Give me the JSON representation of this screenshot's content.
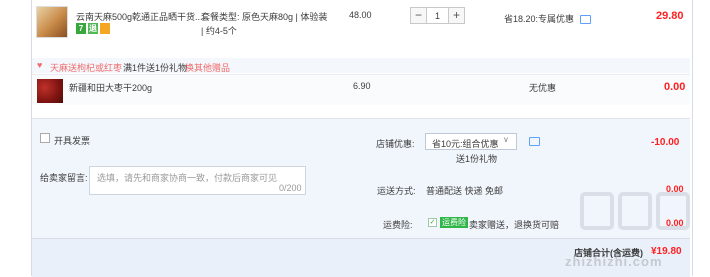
{
  "item1": {
    "title": "云南天麻500g乾通正品晒干货...",
    "tags": [
      "7",
      "退",
      ""
    ],
    "spec": "套餐类型: 原色天麻80g | 体验装 | 约4-5个",
    "price": "48.00",
    "quantity": "1",
    "minus": "−",
    "plus": "+",
    "saving": "省18.20:专属优惠",
    "total": "29.80"
  },
  "gift": {
    "heart": "♥",
    "label": "天麻送枸杞或红枣",
    "rule": "满1件送1份礼物",
    "change_link": "换其他赠品"
  },
  "item2": {
    "title": "新疆和田大枣干200g",
    "price": "6.90",
    "discount": "无优惠",
    "total": "0.00"
  },
  "invoice": {
    "label": "开具发票"
  },
  "message": {
    "label": "给卖家留言:",
    "placeholder": "选填，请先和商家协商一致，付款后商家可见",
    "count": "0/200"
  },
  "store_discount": {
    "label": "店铺优惠:",
    "selected": "省10元:组合优惠",
    "arrow": "∨",
    "gift": "送1份礼物",
    "amount": "-10.00"
  },
  "shipping": {
    "label": "运送方式:",
    "value": "普通配送 快递 免邮",
    "amount": "0.00"
  },
  "insurance": {
    "label": "运费险:",
    "check": "✓",
    "badge": "运费险",
    "text": "卖家赠送，退换货可赔",
    "amount": "0.00"
  },
  "summary": {
    "label": "店铺合计(含运费)",
    "amount": "¥19.80"
  },
  "watermark": {
    "text": "zhizhizhi.com"
  },
  "colors": {
    "price_red": "#ff1f1f",
    "bg_blue": "#f1f6fc",
    "gift_red": "#f06b6b"
  }
}
